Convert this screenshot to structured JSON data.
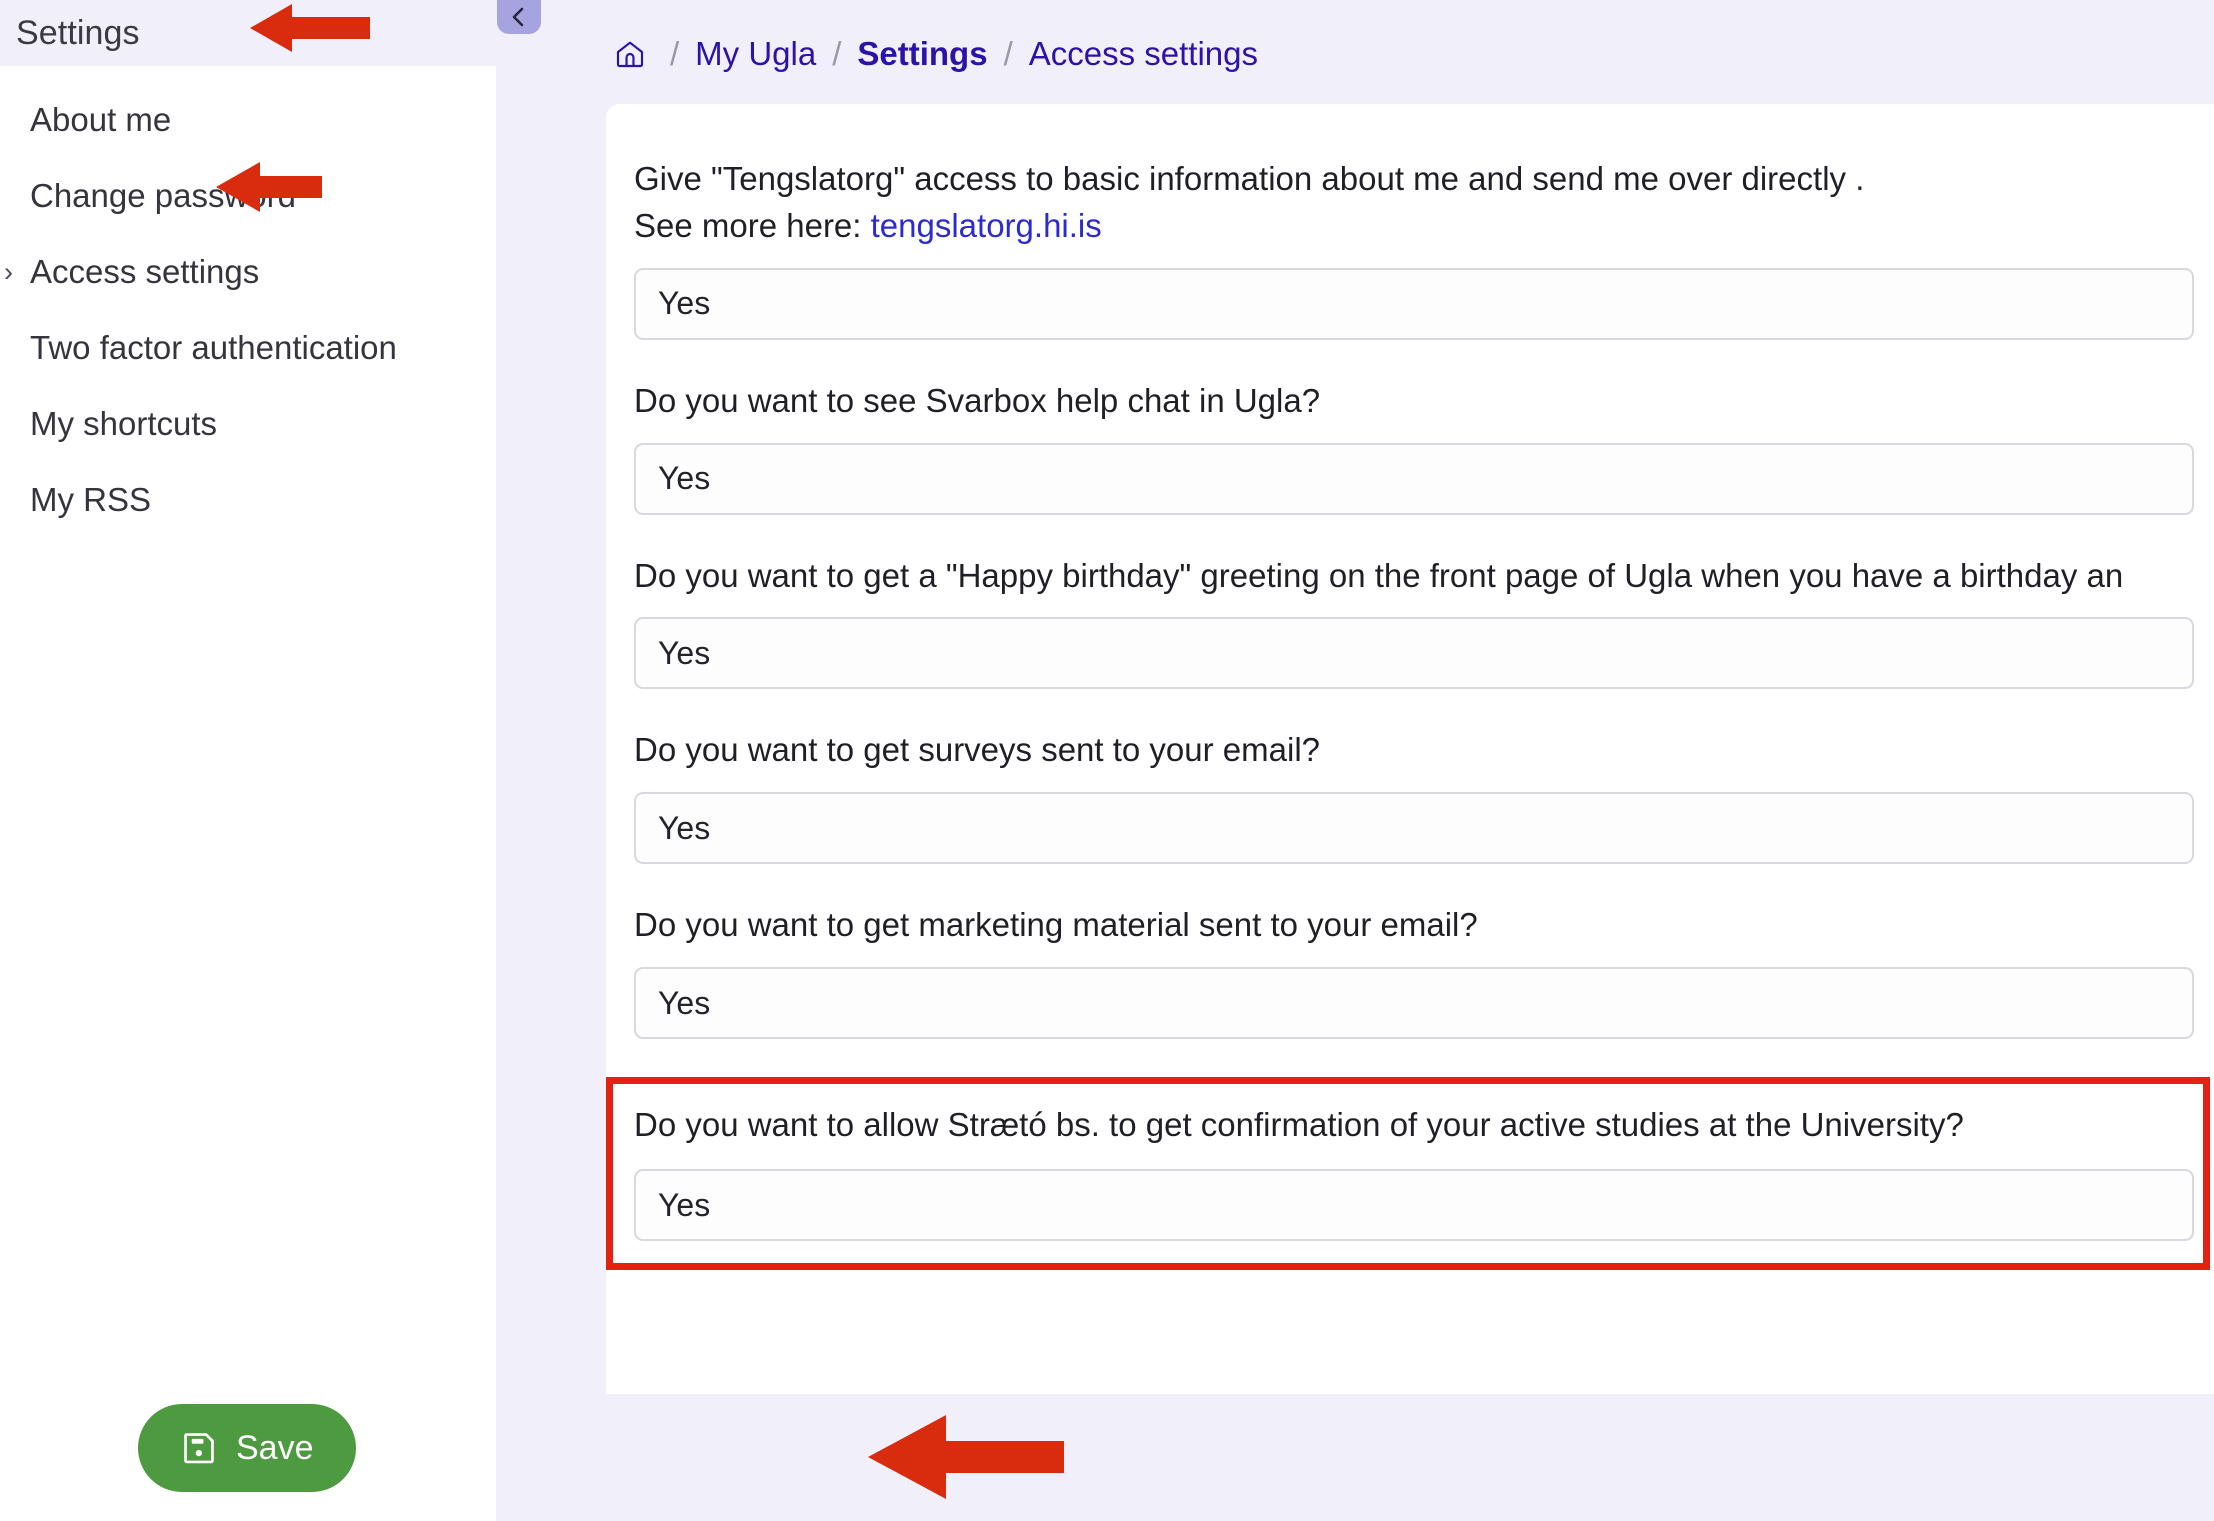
{
  "sidebar": {
    "header_title": "Settings",
    "collapse_icon": "chevron-left-icon",
    "items": [
      {
        "label": "About me",
        "has_chevron": false,
        "active": false
      },
      {
        "label": "Change password",
        "has_chevron": false,
        "active": false
      },
      {
        "label": "Access settings",
        "has_chevron": true,
        "active": true
      },
      {
        "label": "Two factor authentication",
        "has_chevron": false,
        "active": false
      },
      {
        "label": "My shortcuts",
        "has_chevron": false,
        "active": false
      },
      {
        "label": "My RSS",
        "has_chevron": false,
        "active": false
      }
    ]
  },
  "breadcrumb": {
    "home_icon": "home-icon",
    "separator": "/",
    "crumbs": [
      {
        "label": "My Ugla",
        "bold": false
      },
      {
        "label": "Settings",
        "bold": true
      },
      {
        "label": "Access settings",
        "bold": false
      }
    ]
  },
  "main": {
    "fields": [
      {
        "id": "tengslatorg-access",
        "label_line1": "Give \"Tengslatorg\" access to basic information about me and send me over directly .",
        "label_line2_prefix": "See more here: ",
        "link_text": "tengslatorg.hi.is",
        "value": "Yes",
        "highlighted": false
      },
      {
        "id": "svarbox-chat",
        "label_line1": "Do you want to see Svarbox help chat in Ugla?",
        "value": "Yes",
        "highlighted": false
      },
      {
        "id": "birthday-greeting",
        "label_line1": "Do you want to get a \"Happy birthday\" greeting on the front page of Ugla when you have a birthday an",
        "value": "Yes",
        "highlighted": false
      },
      {
        "id": "surveys-email",
        "label_line1": "Do you want to get surveys sent to your email?",
        "value": "Yes",
        "highlighted": false
      },
      {
        "id": "marketing-email",
        "label_line1": "Do you want to get marketing material sent to your email?",
        "value": "Yes",
        "highlighted": false
      },
      {
        "id": "straeto-confirmation",
        "label_line1": "Do you want to allow Strætó bs. to get confirmation of your active studies at the University?",
        "value": "Yes",
        "highlighted": true
      }
    ],
    "save_label": "Save",
    "save_icon": "save-floppy-icon"
  },
  "annotations": {
    "arrow_color": "#d92b0e",
    "highlight_box_color": "#e32213",
    "arrows": [
      {
        "name": "arrow-to-settings-header",
        "points_to": "Settings"
      },
      {
        "name": "arrow-to-access-settings",
        "points_to": "Access settings"
      },
      {
        "name": "arrow-to-save-button",
        "points_to": "Save"
      }
    ]
  },
  "colors": {
    "page_bg": "#f1effa",
    "sidebar_bg": "#ffffff",
    "sidebar_header_bg": "#f1effa",
    "breadcrumb_link": "#2b13a8",
    "inline_link": "#2b2bd0",
    "save_green": "#4e9a40",
    "collapse_purple": "#a6a4e0",
    "select_border": "#d8d8de"
  }
}
